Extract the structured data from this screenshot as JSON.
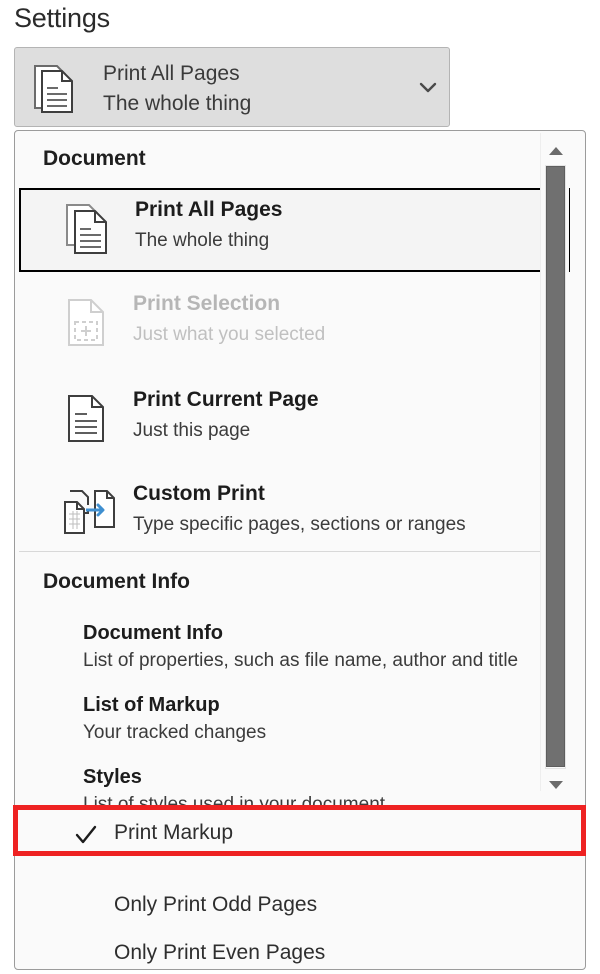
{
  "page": {
    "heading": "Settings"
  },
  "combo": {
    "primary_label": "Print All Pages",
    "secondary_label": "The whole thing",
    "icon": "document-pages-icon",
    "chevron_icon": "chevron-down-icon"
  },
  "dropdown": {
    "groups": [
      {
        "header": "Document",
        "items": [
          {
            "title": "Print All Pages",
            "subtitle": "The whole thing",
            "icon": "document-pages-icon",
            "state": "selected"
          },
          {
            "title": "Print Selection",
            "subtitle": "Just what you selected",
            "icon": "document-selection-icon",
            "state": "disabled"
          },
          {
            "title": "Print Current Page",
            "subtitle": "Just this page",
            "icon": "document-single-page-icon",
            "state": "enabled"
          },
          {
            "title": "Custom Print",
            "subtitle": "Type specific pages, sections or ranges",
            "icon": "document-custom-range-icon",
            "state": "enabled"
          }
        ]
      },
      {
        "header": "Document Info",
        "items": [
          {
            "title": "Document Info",
            "subtitle": "List of properties, such as file name, author and title"
          },
          {
            "title": "List of Markup",
            "subtitle": "Your tracked changes"
          },
          {
            "title": "Styles",
            "subtitle": "List of styles used in your document"
          }
        ]
      }
    ],
    "toggles": [
      {
        "label": "Print Markup",
        "checked": true,
        "check_icon": "checkmark-icon",
        "highlighted": true
      },
      {
        "label": "Only Print Odd Pages",
        "checked": false,
        "check_icon": "checkmark-icon",
        "highlighted": false
      },
      {
        "label": "Only Print Even Pages",
        "checked": false,
        "check_icon": "checkmark-icon",
        "highlighted": false
      }
    ],
    "scrollbar": {
      "up_icon": "scroll-up-arrow-icon",
      "down_icon": "scroll-down-arrow-icon",
      "thumb": "scrollbar-thumb"
    }
  },
  "colors": {
    "highlight_red": "#ee2222",
    "accent_blue": "#3f8fd0",
    "panel_bg": "#fafafa",
    "combo_bg": "#dedede",
    "selected_border": "#000000"
  }
}
